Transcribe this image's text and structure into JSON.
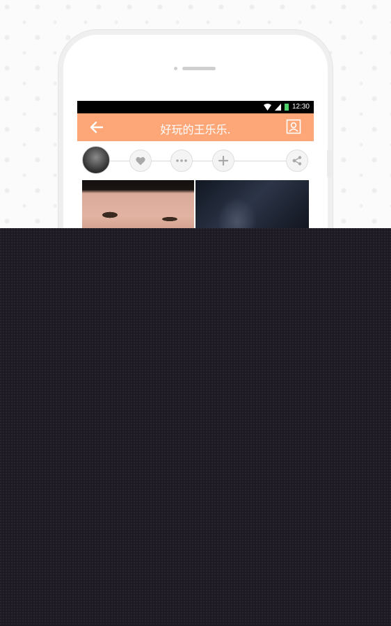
{
  "status_bar": {
    "time": "12:30"
  },
  "app_bar": {
    "title": "好玩的王乐乐.",
    "back_icon": "arrow-left-icon",
    "profile_icon": "user-card-icon"
  },
  "actions": {
    "like_icon": "heart-icon",
    "more_icon": "more-dots-icon",
    "add_icon": "plus-icon",
    "share_icon": "share-icon"
  },
  "colors": {
    "accent": "#fda779",
    "overlay": "#1d1a24",
    "status_bar": "#000000"
  }
}
